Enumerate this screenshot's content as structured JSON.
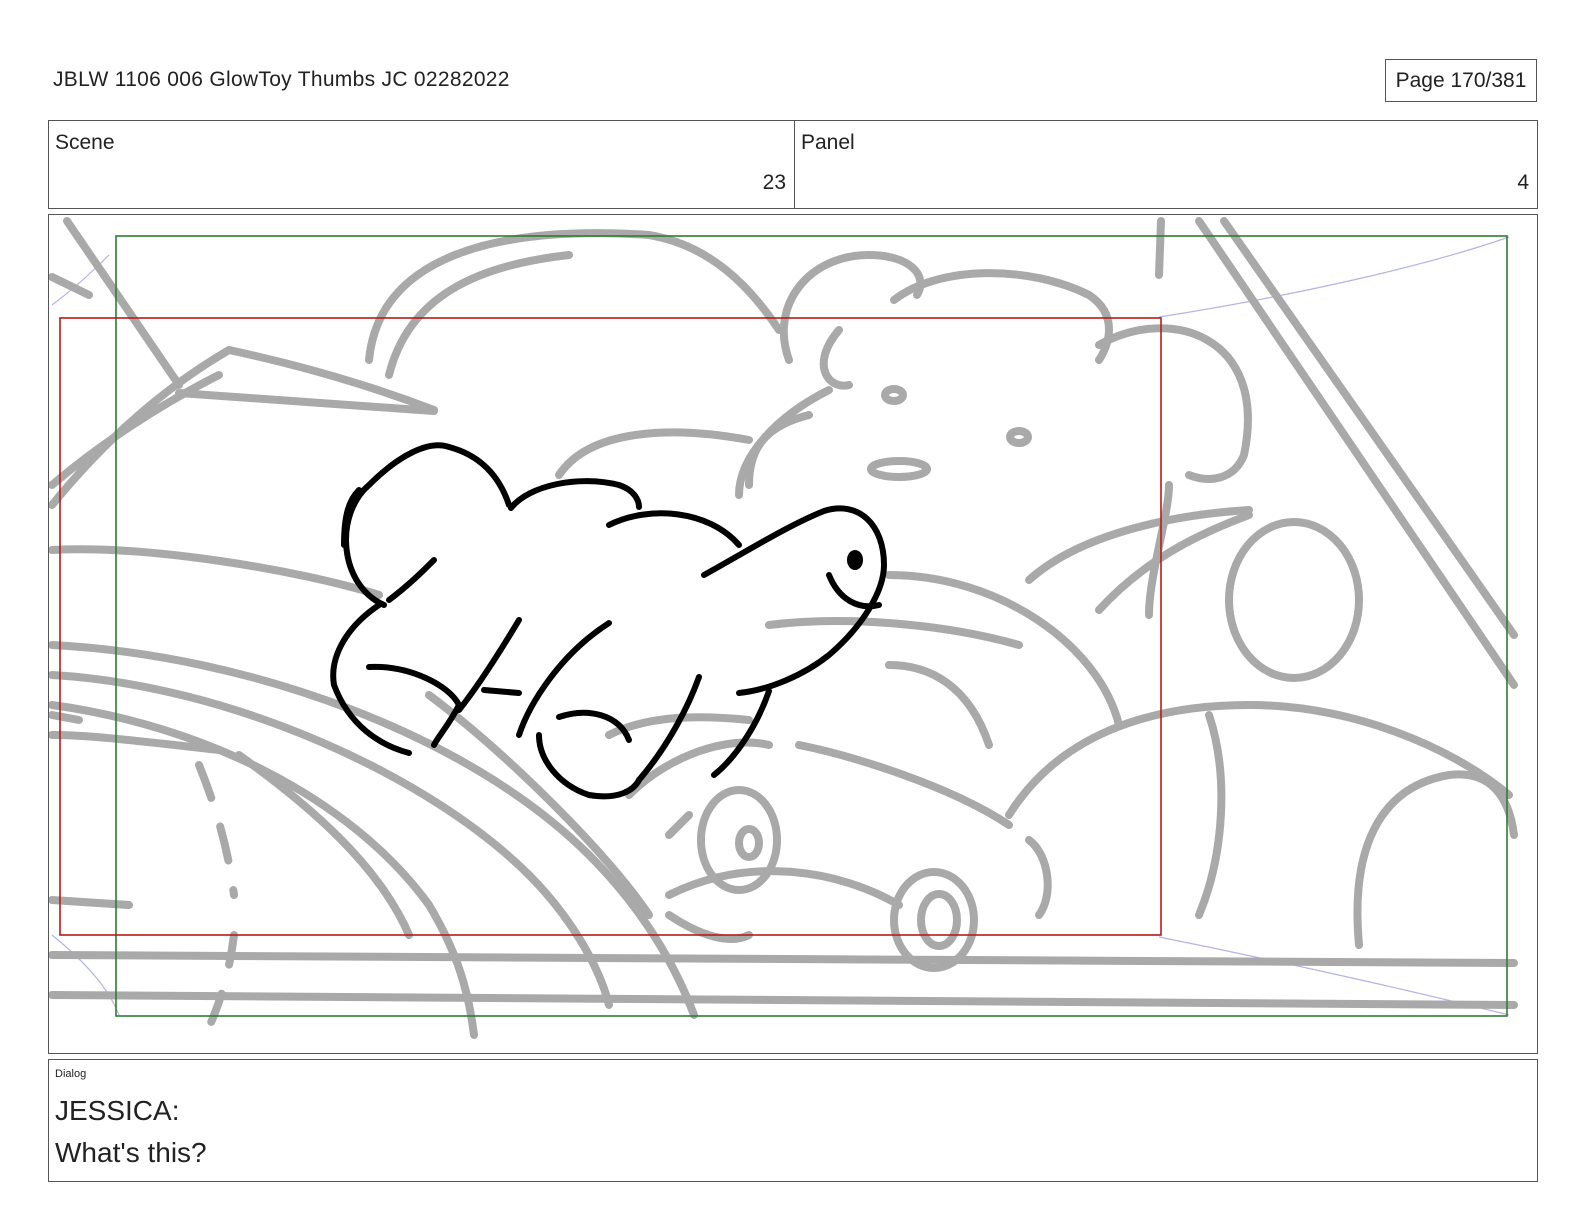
{
  "header": {
    "document_title": "JBLW 1106 006 GlowToy Thumbs JC 02282022",
    "page_indicator": "Page 170/381"
  },
  "info": {
    "scene_label": "Scene",
    "scene_value": "23",
    "panel_label": "Panel",
    "panel_value": "4"
  },
  "frame": {
    "colors": {
      "safe_area": "#2e7d32",
      "action_area": "#b71c1c",
      "background_sketch": "#a9a9a9",
      "foreground_sketch": "#000000",
      "guide_lines": "#b3b3e6"
    }
  },
  "dialog": {
    "label": "Dialog",
    "lines": [
      "JESSICA:",
      "What's this?"
    ]
  }
}
